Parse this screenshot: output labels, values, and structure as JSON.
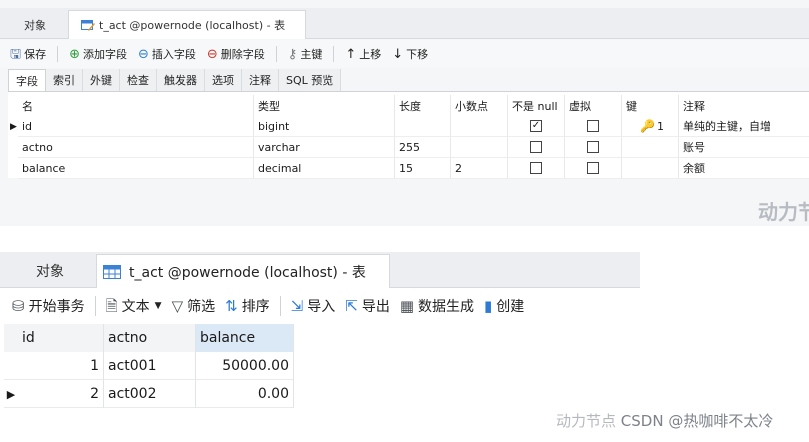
{
  "designer": {
    "tabs": {
      "objects": "对象",
      "active": "t_act @powernode (localhost) - 表"
    },
    "toolbar": {
      "save": "保存",
      "add_field": "添加字段",
      "insert_field": "插入字段",
      "delete_field": "删除字段",
      "primary_key": "主键",
      "move_up": "上移",
      "move_down": "下移"
    },
    "subtabs": [
      "字段",
      "索引",
      "外键",
      "检查",
      "触发器",
      "选项",
      "注释",
      "SQL 预览"
    ],
    "columns": [
      "名",
      "类型",
      "长度",
      "小数点",
      "不是 null",
      "虚拟",
      "键",
      "注释"
    ],
    "rows": [
      {
        "name": "id",
        "type": "bigint",
        "length": "",
        "decimals": "",
        "not_null": true,
        "virtual": false,
        "key": "1",
        "comment": "单纯的主键，自增"
      },
      {
        "name": "actno",
        "type": "varchar",
        "length": "255",
        "decimals": "",
        "not_null": false,
        "virtual": false,
        "key": "",
        "comment": "账号"
      },
      {
        "name": "balance",
        "type": "decimal",
        "length": "15",
        "decimals": "2",
        "not_null": false,
        "virtual": false,
        "key": "",
        "comment": "余额"
      }
    ],
    "watermark": "动力节"
  },
  "dataview": {
    "tabs": {
      "objects": "对象",
      "active": "t_act @powernode (localhost) - 表"
    },
    "toolbar": {
      "begin_tx": "开始事务",
      "text": "文本",
      "filter": "筛选",
      "sort": "排序",
      "import": "导入",
      "export": "导出",
      "data_gen": "数据生成",
      "create": "创建"
    },
    "columns": [
      "id",
      "actno",
      "balance"
    ],
    "rows": [
      {
        "id": "1",
        "actno": "act001",
        "balance": "50000.00"
      },
      {
        "id": "2",
        "actno": "act002",
        "balance": "0.00"
      }
    ]
  },
  "footer": {
    "ghost": "动力节点",
    "credit": "CSDN @热咖啡不太冷"
  },
  "colors": {
    "accent": "#2e7bd6",
    "key_icon": "#d69a00",
    "selected_header": "#dbe9f7"
  }
}
